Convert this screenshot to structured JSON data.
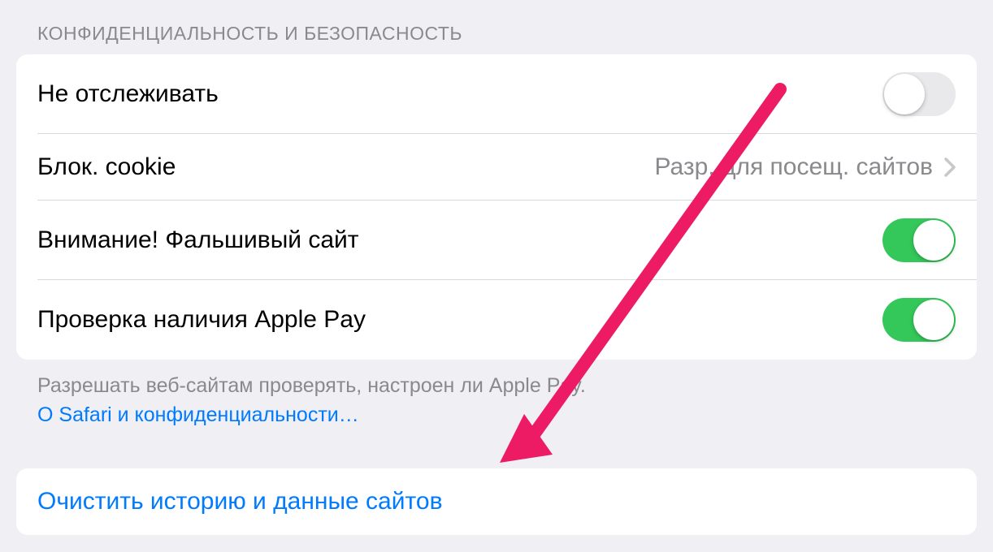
{
  "section": {
    "header": "КОНФИДЕНЦИАЛЬНОСТЬ И БЕЗОПАСНОСТЬ"
  },
  "rows": {
    "doNotTrack": {
      "label": "Не отслеживать",
      "enabled": false
    },
    "blockCookies": {
      "label": "Блок. cookie",
      "detail": "Разр. для посещ. сайтов"
    },
    "fraudWarning": {
      "label": "Внимание! Фальшивый сайт",
      "enabled": true
    },
    "checkApplePay": {
      "label": "Проверка наличия Apple Pay",
      "enabled": true
    }
  },
  "footer": {
    "line1": "Разрешать веб-сайтам проверять, настроен ли Apple Pay.",
    "link": "О Safari и конфиденциальности…"
  },
  "action": {
    "clearHistory": "Очистить историю и данные сайтов"
  },
  "colors": {
    "link": "#007aff",
    "toggleOn": "#34c759",
    "textSecondary": "#8a8a8e",
    "arrowAnnotation": "#e91e63"
  }
}
